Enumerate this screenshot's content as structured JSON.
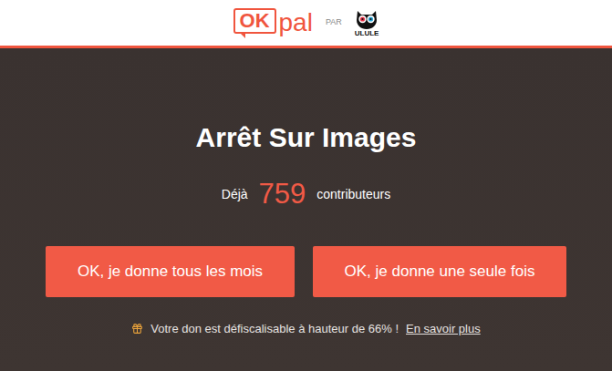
{
  "header": {
    "logo": {
      "brand_box": "OK",
      "brand_rest": "pal",
      "separator": "PAR",
      "partner": "ULULE"
    }
  },
  "campaign": {
    "title": "Arrêt Sur Images",
    "counter": {
      "prefix": "Déjà",
      "count": "759",
      "suffix": "contributeurs"
    }
  },
  "buttons": [
    "OK, je donne tous les mois",
    "OK, je donne une seule fois"
  ],
  "tax_note": {
    "text": "Votre don est défiscalisable à hauteur de 66% !",
    "link": "En savoir plus"
  }
}
